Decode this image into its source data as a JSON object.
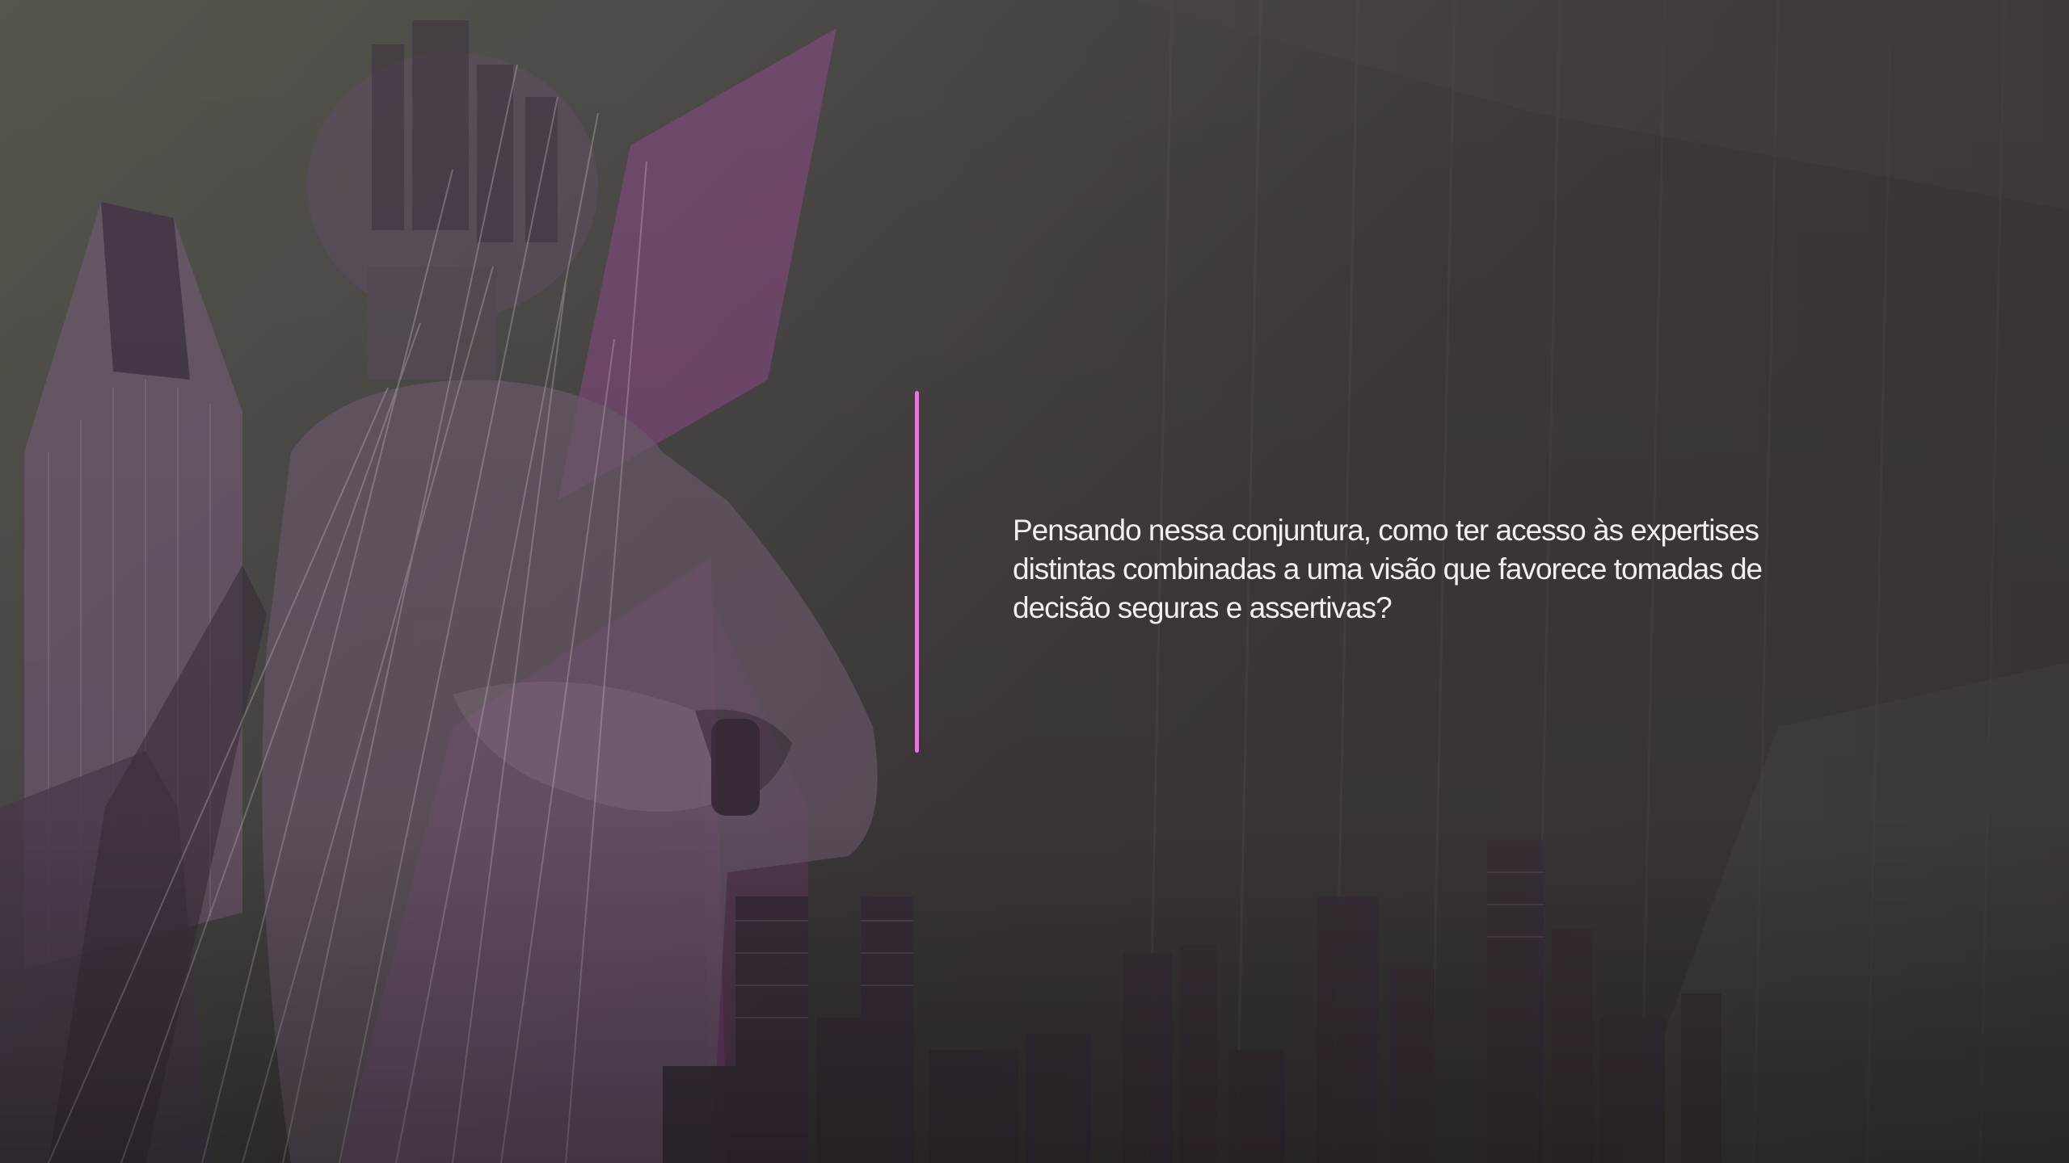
{
  "slide": {
    "body_text": "Pensando nessa conjuntura, como ter acesso às expertises\ndistintas combinadas a uma visão que favorece tomadas de\ndecisão seguras e assertivas?"
  },
  "colors": {
    "accent_line": "#e07ad8",
    "text": "#f4eef3",
    "background_dark": "#3a3436",
    "background_olive": "#55574d",
    "magenta_overlay": "#8a4a86"
  },
  "images": {
    "background": "businessman-double-exposure-city-skyline"
  }
}
